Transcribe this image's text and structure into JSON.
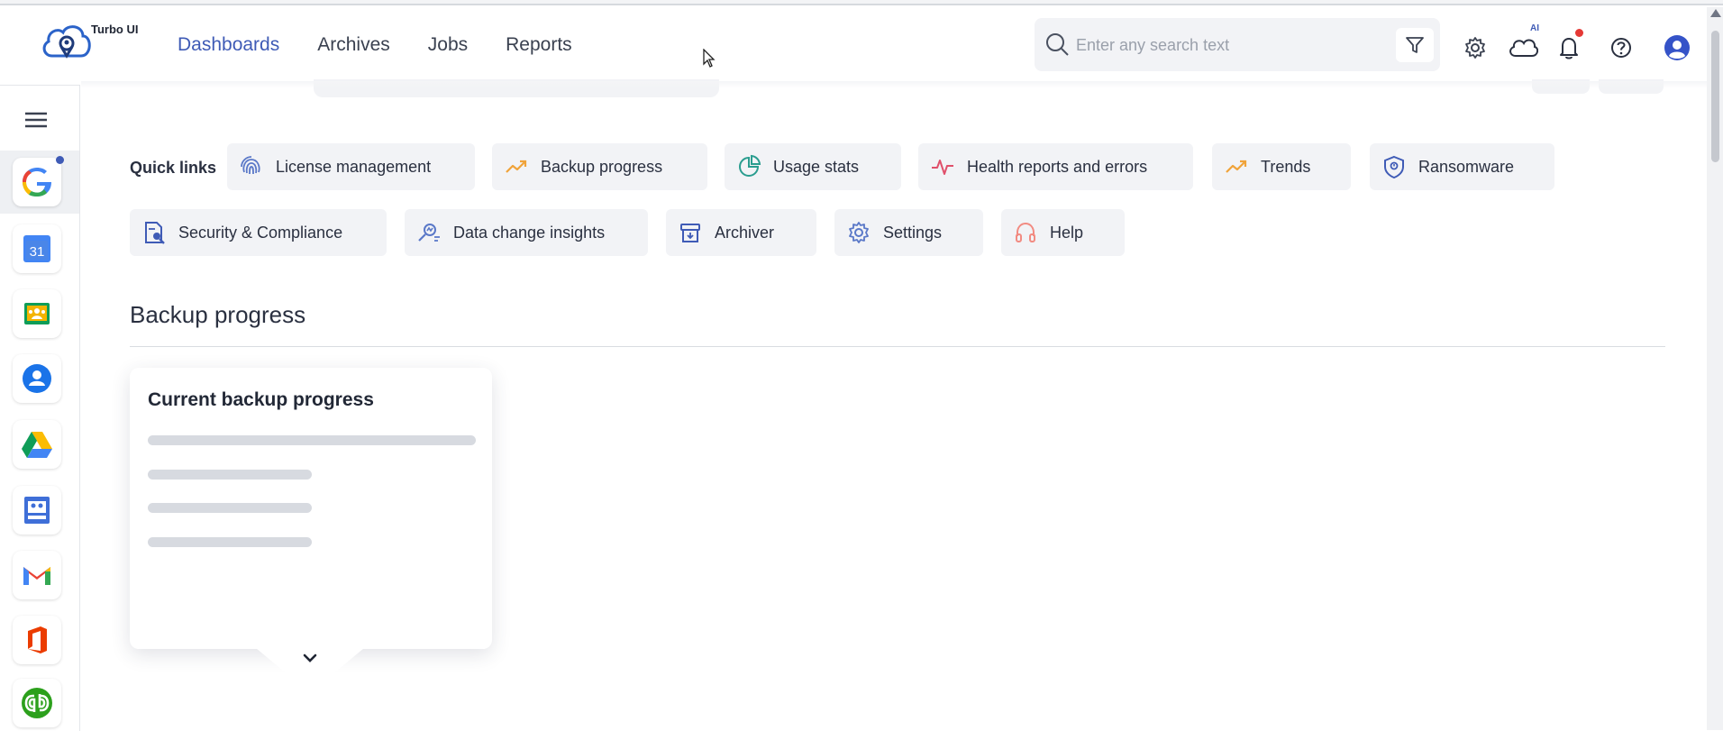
{
  "app": {
    "logo_text": "Turbo UI"
  },
  "nav": {
    "items": [
      "Dashboards",
      "Archives",
      "Jobs",
      "Reports"
    ],
    "active_index": 0
  },
  "search": {
    "placeholder": "Enter any search text"
  },
  "header": {
    "ai_badge": "AI"
  },
  "icons": {
    "nav": [
      "filter-icon",
      "settings-gear-icon",
      "ai-cloud-icon",
      "notification-bell-icon",
      "help-icon",
      "user-avatar-icon"
    ],
    "rail": [
      "google-app-icon",
      "google-calendar-icon",
      "google-classroom-icon",
      "google-contacts-icon",
      "google-drive-icon",
      "google-sites-icon",
      "gmail-icon",
      "office-365-icon",
      "quickbooks-icon"
    ]
  },
  "rail": {
    "apps": [
      "Google",
      "Calendar",
      "Classroom",
      "Contacts",
      "Drive",
      "Sites",
      "Gmail",
      "Office",
      "QuickBooks"
    ],
    "calendar_day": "31"
  },
  "quick_links": {
    "label": "Quick links",
    "row1": [
      "License management",
      "Backup progress",
      "Usage stats",
      "Health reports and errors",
      "Trends",
      "Ransomware"
    ],
    "row2": [
      "Security & Compliance",
      "Data change insights",
      "Archiver",
      "Settings",
      "Help"
    ]
  },
  "section": {
    "title": "Backup progress"
  },
  "card": {
    "title": "Current backup progress"
  },
  "colors": {
    "accent": "#3f5bb6",
    "chip_bg": "#f2f3f6",
    "notification": "#e53935",
    "trend": "#f0a33a",
    "health": "#e0506b",
    "usage": "#2a9d8f"
  }
}
